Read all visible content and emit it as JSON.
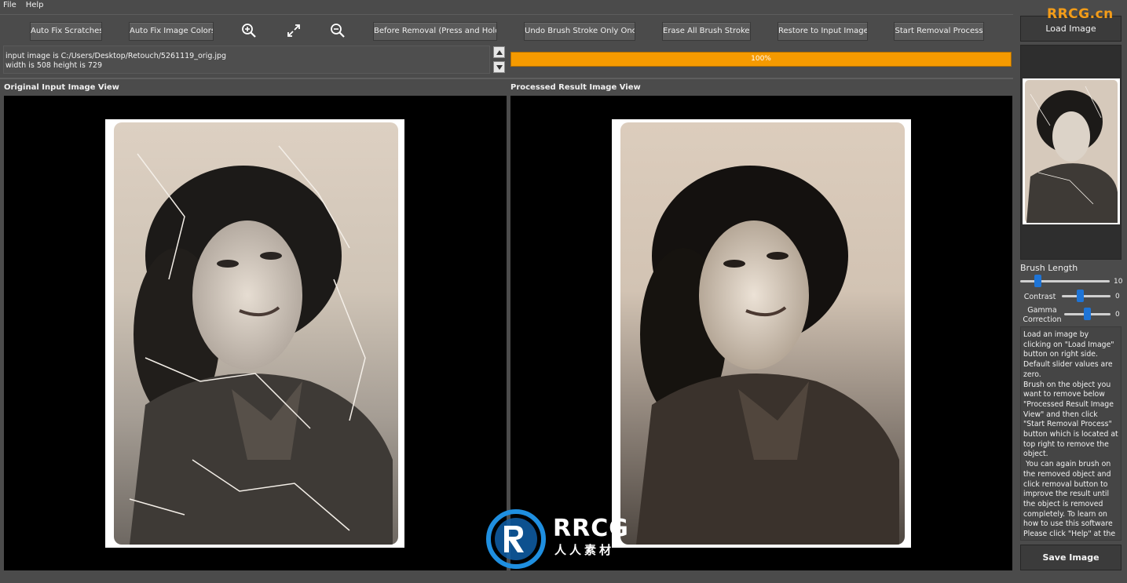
{
  "menu": {
    "file": "File",
    "help": "Help"
  },
  "toolbar": {
    "auto_fix_scratches": "Auto Fix Scratches",
    "auto_fix_colors": "Auto Fix Image Colors",
    "before_removal": "Before Removal (Press and Hold)",
    "undo_stroke": "Undo Brush Stroke Only Once",
    "erase_strokes": "Erase All Brush Strokes",
    "restore_input": "Restore to Input Image",
    "start_removal": "Start Removal Process"
  },
  "icons": {
    "zoom_in": "zoom-in-icon",
    "fit": "fit-to-screen-icon",
    "zoom_out": "zoom-out-icon",
    "scroll_up": "arrow-up-icon",
    "scroll_down": "arrow-down-icon"
  },
  "info": {
    "line1": "input image is C:/Users/Desktop/Retouch/5261119_orig.jpg",
    "line2": "width is 508 height is 729"
  },
  "progress": {
    "value": 1.0,
    "label": "100%"
  },
  "panels": {
    "original_title": "Original Input Image View",
    "processed_title": "Processed Result Image View"
  },
  "sidebar": {
    "load_image": "Load Image",
    "save_image": "Save Image",
    "brush_length_label": "Brush Length",
    "brush_length_value": "10",
    "brush_length_level": 0.17,
    "contrast_label": "Contrast",
    "contrast_value": "0",
    "contrast_level": 0.35,
    "gamma_label": "Gamma\nCorrection",
    "gamma_value": "0",
    "gamma_level": 0.5,
    "help_text": "Load an image by clicking on \"Load Image\" button on right side. Default slider values are zero.\nBrush on the object you want to remove below \"Processed Result Image View\" and then click \"Start Removal Process\" button which is located at top right to remove the object.\n You can again brush on the removed object and click removal button to improve the result until the object is removed completely. To learn on how to use this software Please click \"Help\" at the top and then click \"How to Use the Software\"\npixbim.com"
  },
  "watermark": {
    "top": "RRCG.cn",
    "main": "RRCG",
    "sub": "人人素材"
  },
  "colors": {
    "accent": "#f59a00",
    "slider": "#1e74d6",
    "background": "#4b4b4b"
  }
}
